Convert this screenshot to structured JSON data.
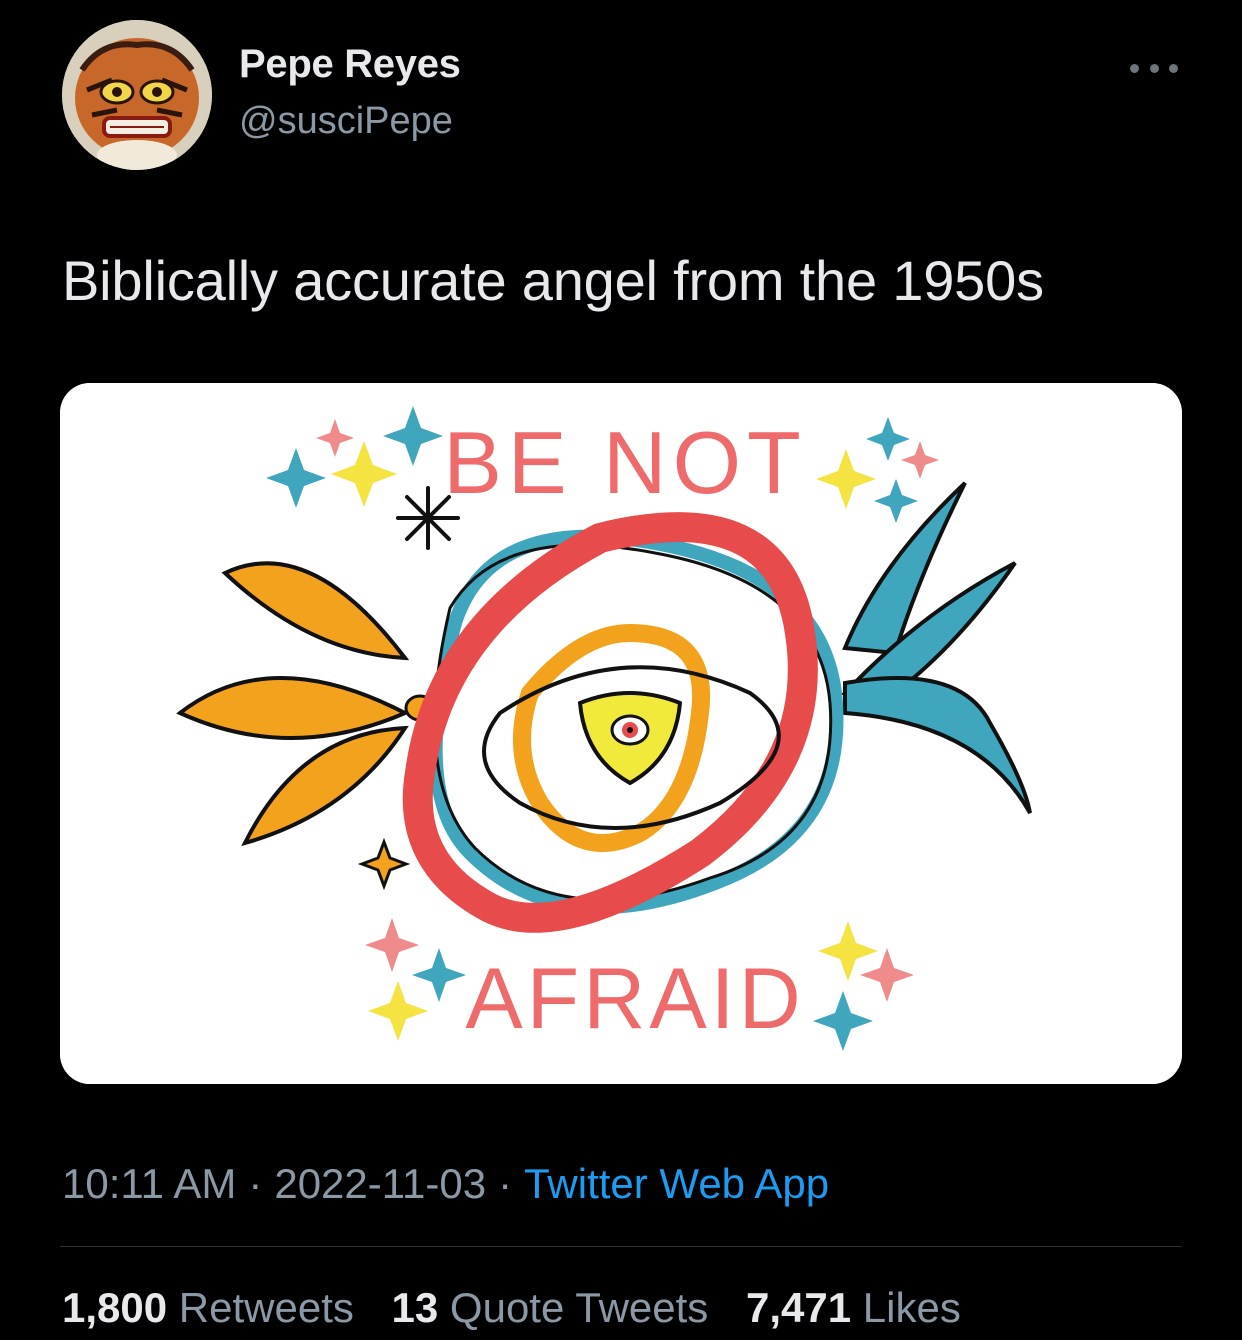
{
  "tweet": {
    "display_name": "Pepe Reyes",
    "handle": "@susciPepe",
    "text": "Biblically accurate angel from the 1950s",
    "image_text": {
      "top": "BE NOT",
      "bottom": "AFRAID"
    },
    "time": "10:11 AM",
    "date": "2022-11-03",
    "separator": "·",
    "source": "Twitter Web App",
    "stats": {
      "retweets_count": "1,800",
      "retweets_label": "Retweets",
      "quotes_count": "13",
      "quotes_label": "Quote Tweets",
      "likes_count": "7,471",
      "likes_label": "Likes"
    }
  },
  "icons": {
    "more": "more-options-icon"
  },
  "colors": {
    "background": "#000000",
    "text": "#e7e9ea",
    "secondary": "#8b98a5",
    "link": "#1d9bf0"
  }
}
